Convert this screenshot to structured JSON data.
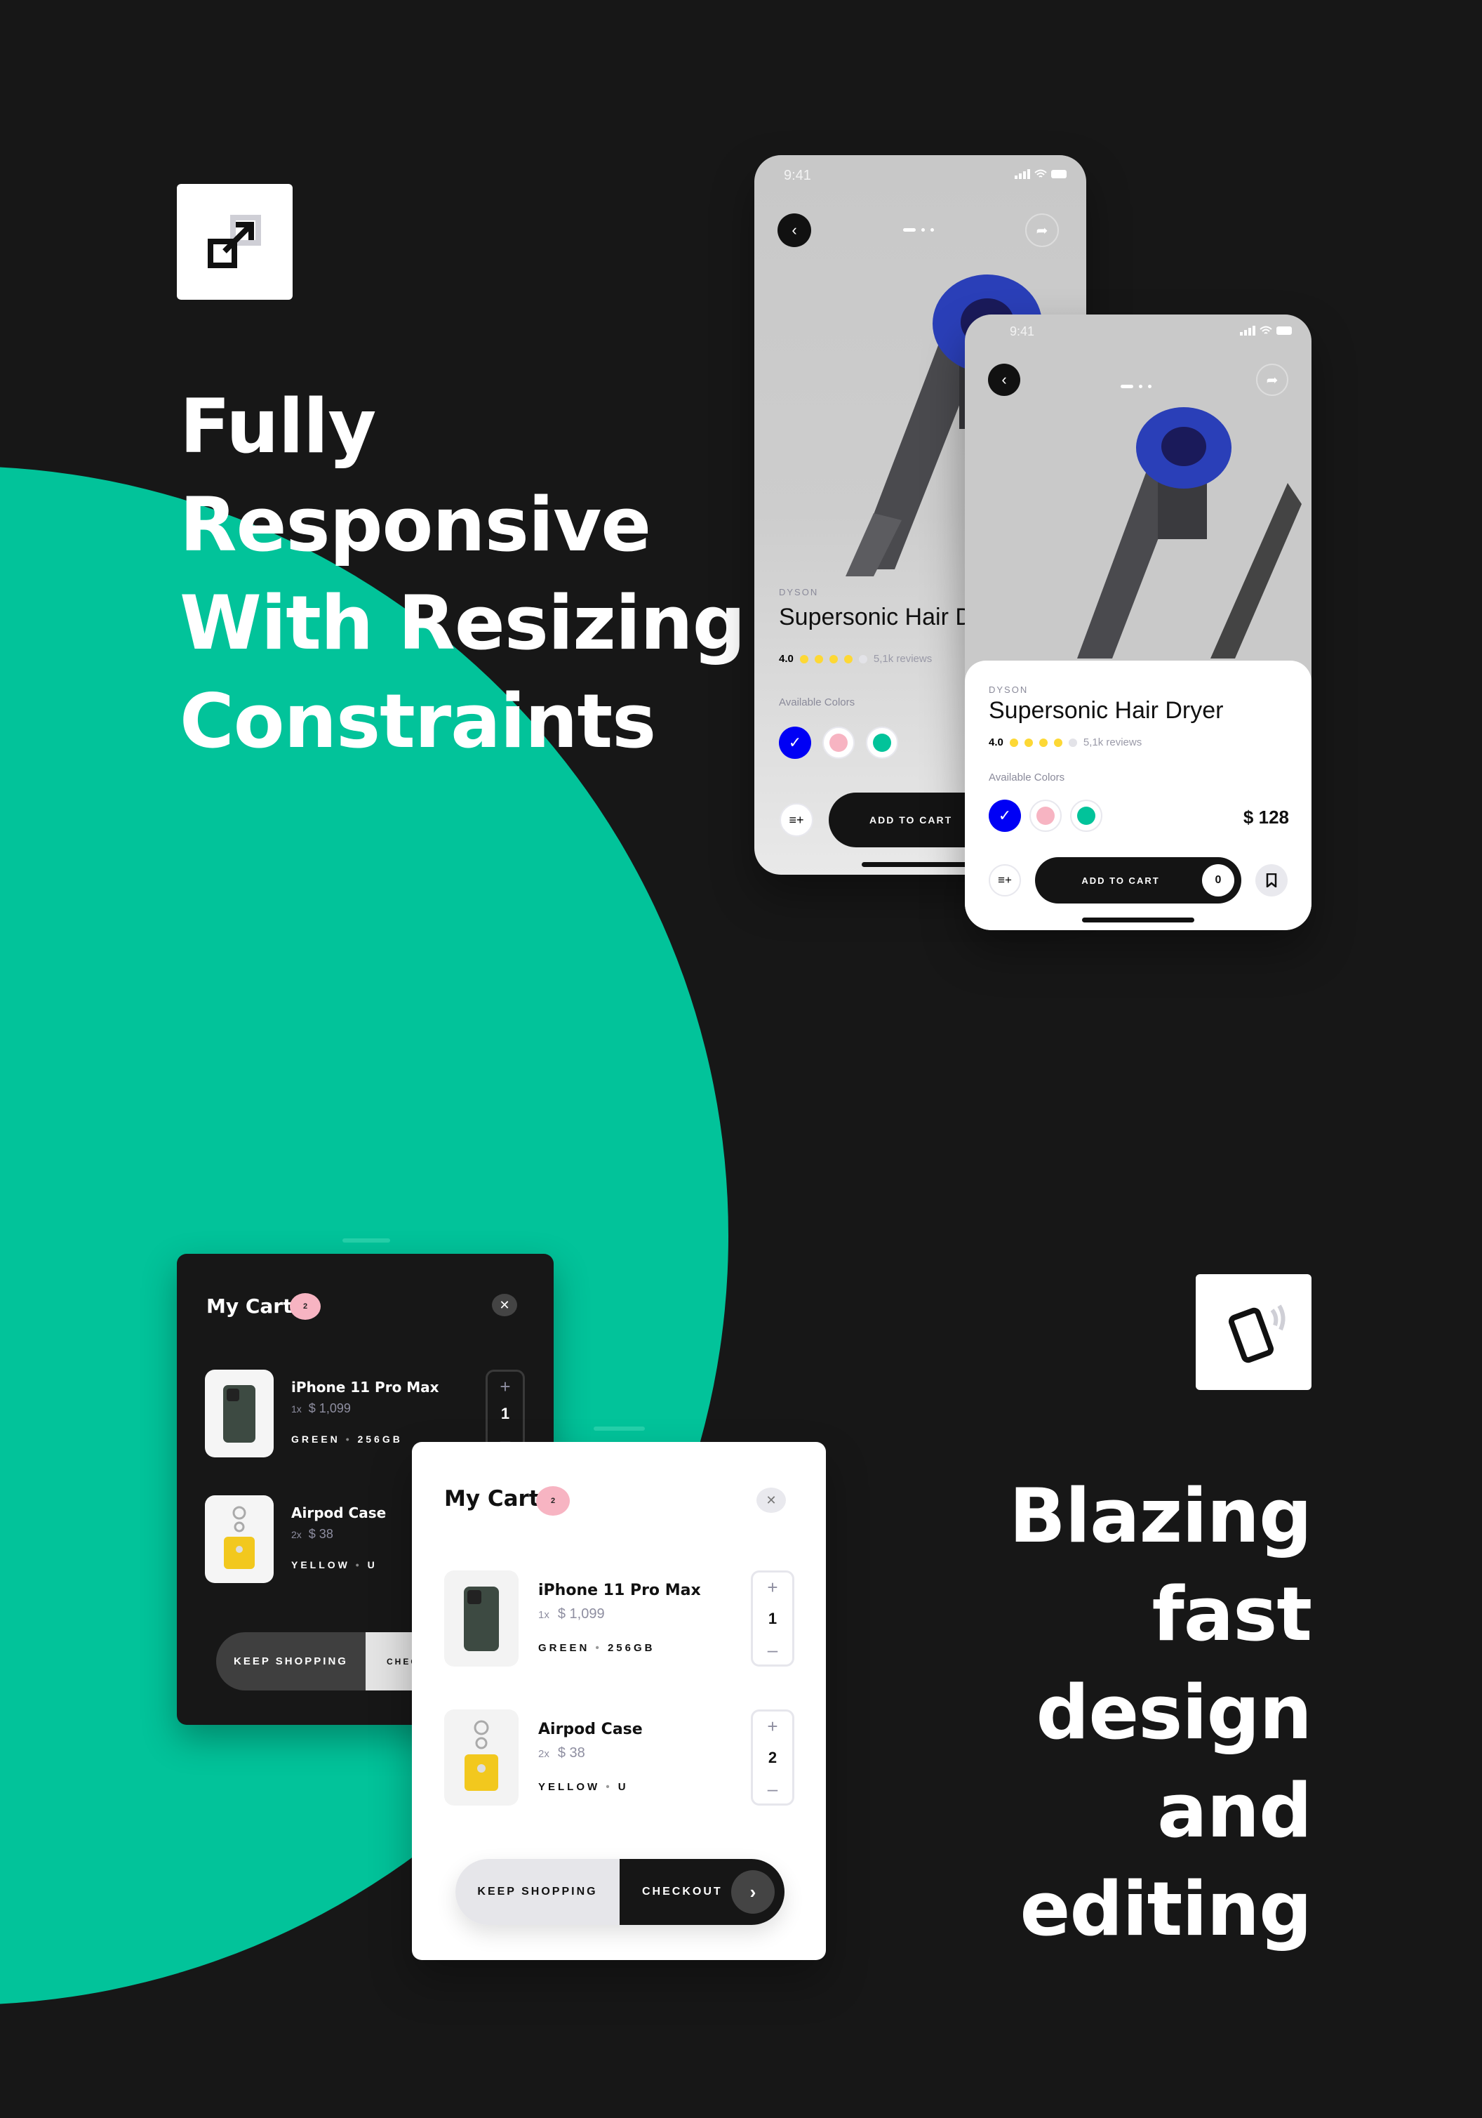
{
  "colors": {
    "background": "#171717",
    "accent": "#02C39A",
    "selected_blue": "#0000F5",
    "pink": "#F7B4C2",
    "green": "#02C39A",
    "star": "#FDD835"
  },
  "headline_top": {
    "lines": [
      "Fully",
      "Responsive",
      "With Resizing",
      "Constraints"
    ]
  },
  "headline_bottom": {
    "lines": [
      "Blazing",
      "fast",
      "design",
      "and",
      "editing"
    ]
  },
  "icons": {
    "top": "resize-arrow-icon",
    "bottom": "phone-rotate-icon"
  },
  "phone_small": {
    "time": "9:41",
    "brand": "DYSON",
    "title": "Supersonic Hair Dryer",
    "rating": "4.0",
    "stars_filled": 4,
    "stars_total": 5,
    "reviews": "5,1k reviews",
    "colors_label": "Available Colors",
    "add_to_cart": "ADD TO CART"
  },
  "phone_large": {
    "time": "9:41",
    "brand": "DYSON",
    "title": "Supersonic Hair Dryer",
    "rating": "4.0",
    "stars_filled": 4,
    "stars_total": 5,
    "reviews": "5,1k reviews",
    "colors_label": "Available Colors",
    "price": "$ 128",
    "add_to_cart": "ADD TO CART",
    "cart_count": "0"
  },
  "cart": {
    "title": "My Cart",
    "count": "2",
    "items": [
      {
        "name": "iPhone 11 Pro Max",
        "qty_label": "1x",
        "price": "$ 1,099",
        "color": "GREEN",
        "variant": "256GB",
        "quantity": "1"
      },
      {
        "name": "Airpod Case",
        "qty_label": "2x",
        "price": "$ 38",
        "color": "YELLOW",
        "variant": "U",
        "quantity": "2"
      }
    ],
    "keep_shopping": "KEEP SHOPPING",
    "checkout": "CHECKOUT",
    "checkout_short": "CHEC"
  }
}
